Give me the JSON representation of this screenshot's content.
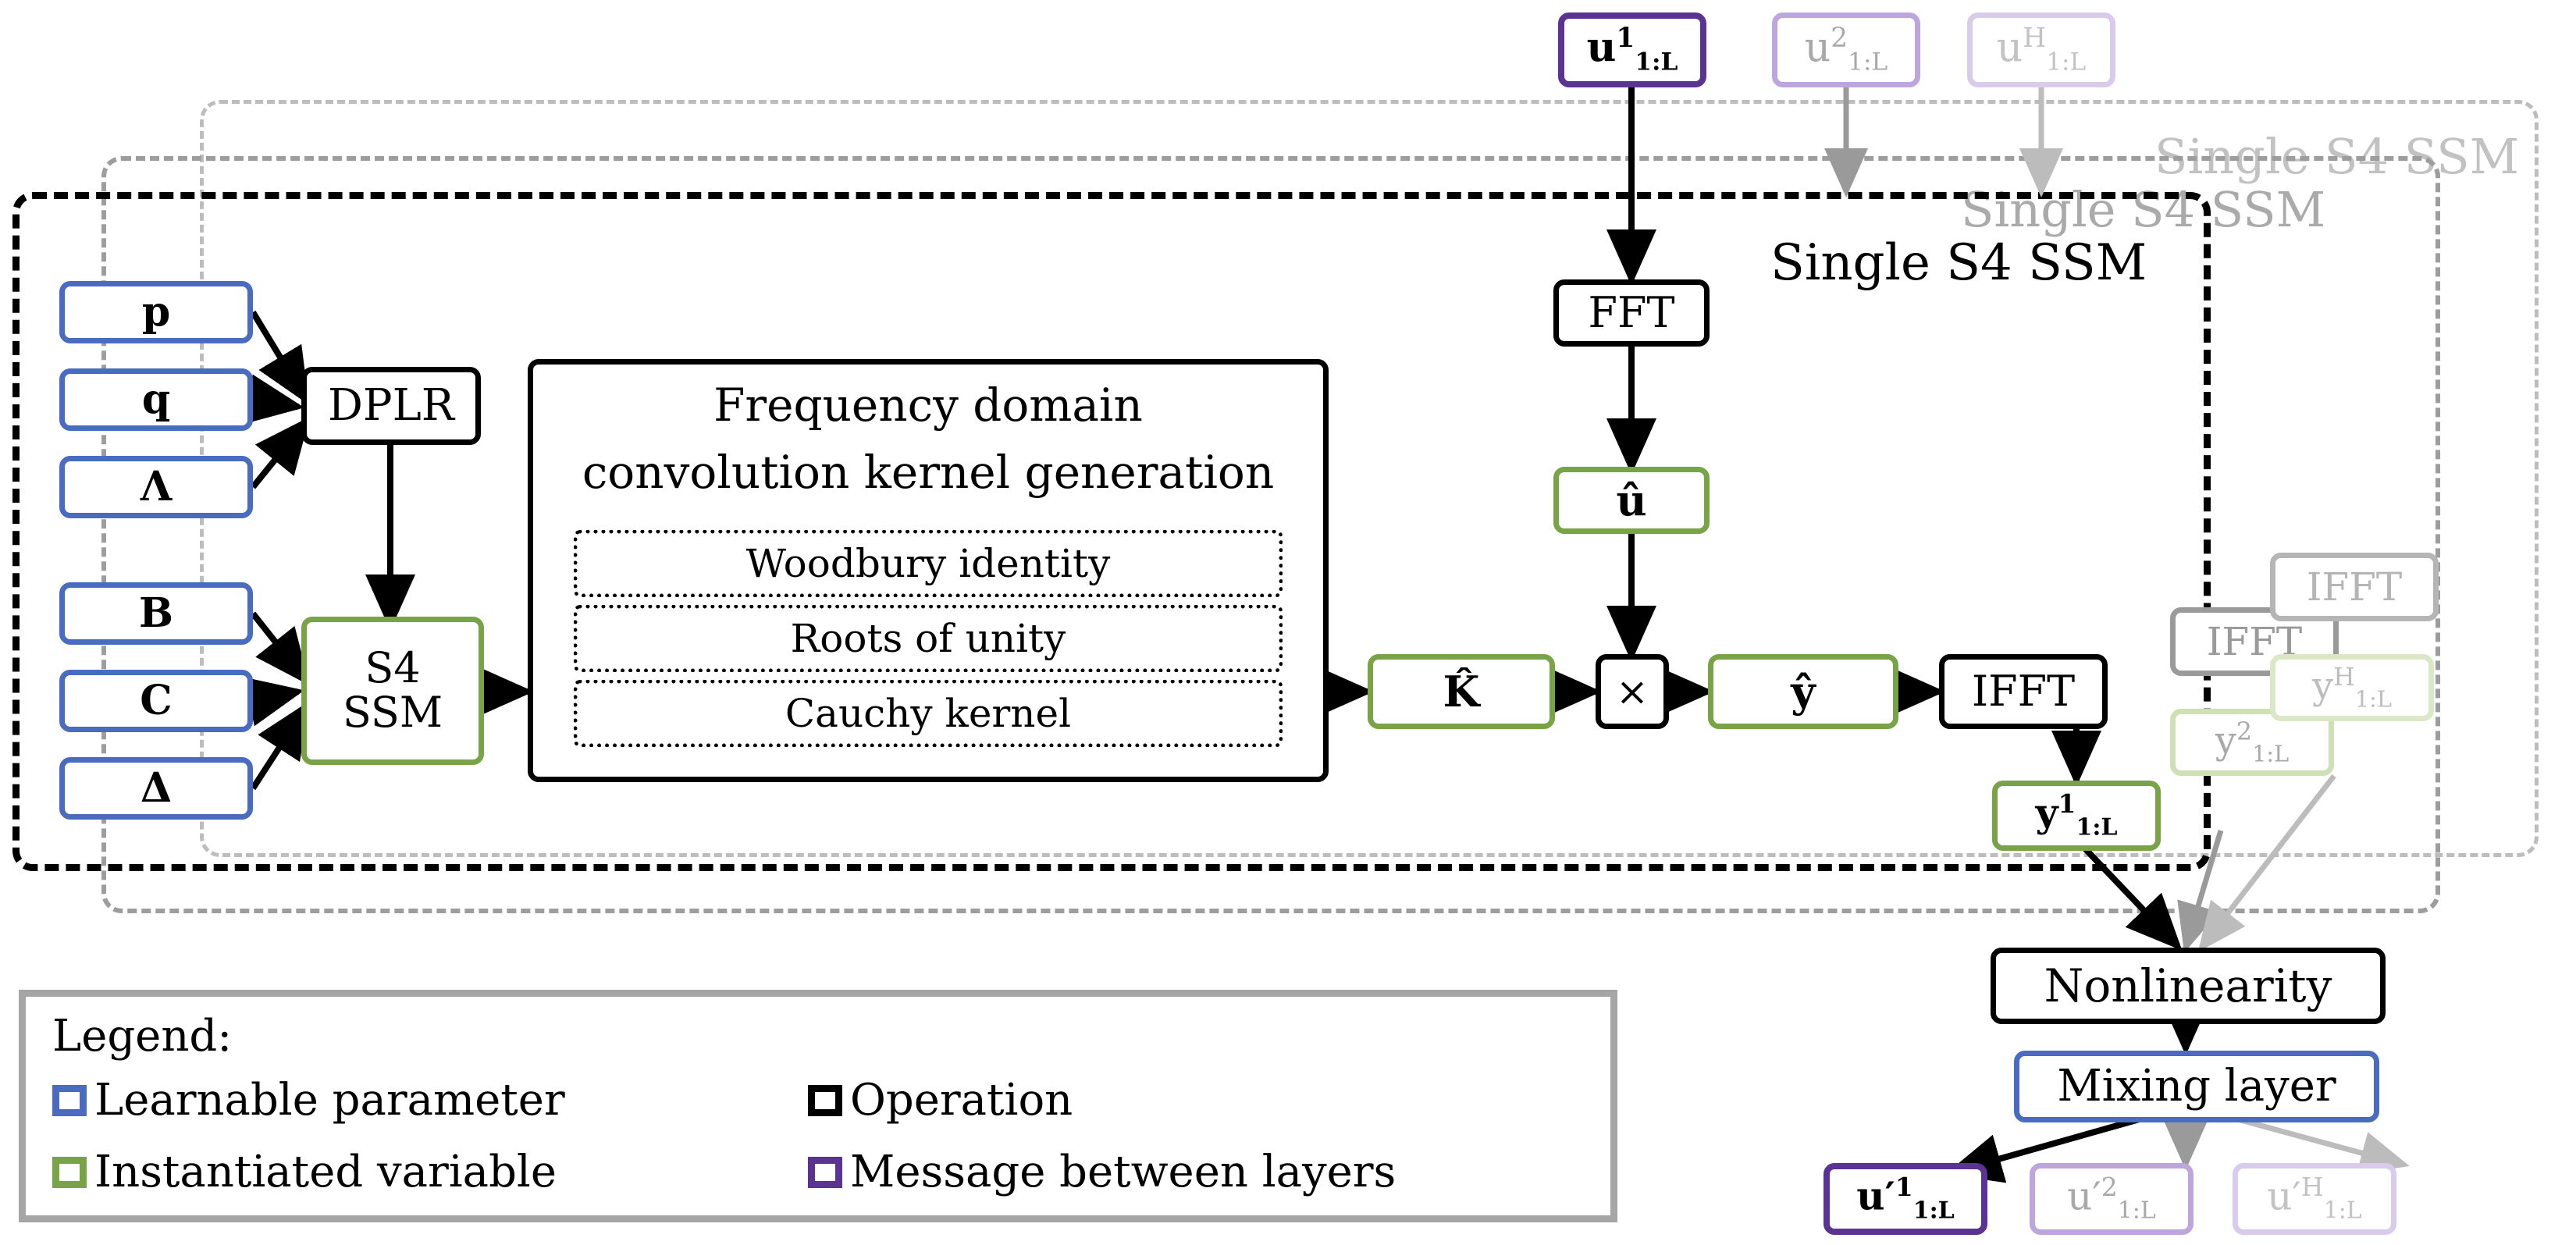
{
  "diagram": {
    "title_group_main": "Single S4 SSM",
    "title_group_back1": "Single S4 SSM",
    "title_group_back2": "Single S4 SSM"
  },
  "inputs": [
    {
      "id": "u1",
      "base": "u",
      "sup": "1",
      "sub": "1:L",
      "state": "active"
    },
    {
      "id": "u2",
      "base": "u",
      "sup": "2",
      "sub": "1:L",
      "state": "faded"
    },
    {
      "id": "uH",
      "base": "u",
      "sup": "H",
      "sub": "1:L",
      "state": "faded2"
    }
  ],
  "params": [
    {
      "id": "p",
      "label": "p"
    },
    {
      "id": "q",
      "label": "q"
    },
    {
      "id": "lambda",
      "label": "Λ"
    },
    {
      "id": "B",
      "label": "B"
    },
    {
      "id": "C",
      "label": "C"
    },
    {
      "id": "delta",
      "label": "Δ"
    }
  ],
  "ops": {
    "dplr": "DPLR",
    "s4ssm_line1": "S4",
    "s4ssm_line2": "SSM",
    "fft": "FFT",
    "ifft": "IFFT",
    "multiply": "×",
    "nonlinearity": "Nonlinearity",
    "mixing_layer": "Mixing layer"
  },
  "kernel_block": {
    "title_line1": "Frequency domain",
    "title_line2": "convolution kernel generation",
    "items": [
      "Woodbury identity",
      "Roots of unity",
      "Cauchy kernel"
    ]
  },
  "vars": {
    "u_hat": "û",
    "K_hat": "K̂",
    "y_hat": "ŷ"
  },
  "outputs_y": [
    {
      "id": "y1",
      "base": "y",
      "sup": "1",
      "sub": "1:L",
      "state": "active"
    },
    {
      "id": "y2",
      "base": "y",
      "sup": "2",
      "sub": "1:L",
      "state": "faded"
    },
    {
      "id": "yH",
      "base": "y",
      "sup": "H",
      "sub": "1:L",
      "state": "faded2"
    }
  ],
  "outputs_u": [
    {
      "id": "up1",
      "base": "u′",
      "sup": "1",
      "sub": "1:L",
      "state": "active"
    },
    {
      "id": "up2",
      "base": "u′",
      "sup": "2",
      "sub": "1:L",
      "state": "faded"
    },
    {
      "id": "upH",
      "base": "u′",
      "sup": "H",
      "sub": "1:L",
      "state": "faded2"
    }
  ],
  "faded_ops": {
    "ifft_back1": "IFFT",
    "ifft_back2": "IFFT"
  },
  "legend": {
    "title": "Legend:",
    "entries": [
      {
        "label": "Learnable parameter",
        "color": "#4a6cc0",
        "swatch": "sw-blue"
      },
      {
        "label": "Operation",
        "color": "#000000",
        "swatch": "sw-black"
      },
      {
        "label": "Instantiated variable",
        "color": "#79a347",
        "swatch": "sw-green"
      },
      {
        "label": "Message between layers",
        "color": "#5b3392",
        "swatch": "sw-purple"
      }
    ]
  },
  "colors": {
    "learnable": "#4a6cc0",
    "instantiated": "#79a347",
    "operation": "#000000",
    "message": "#5b3392",
    "faded": "#9d9d9d"
  }
}
